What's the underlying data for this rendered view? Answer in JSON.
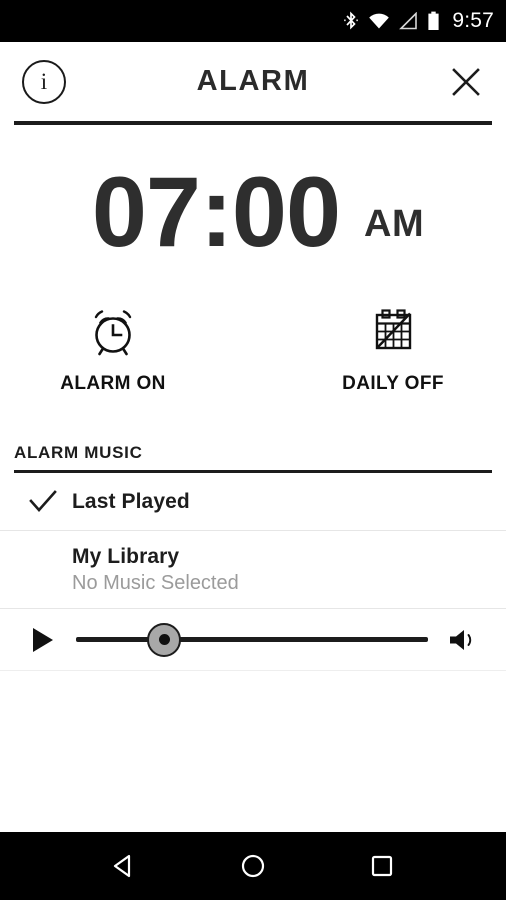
{
  "status_bar": {
    "time": "9:57",
    "icons": [
      "bluetooth-icon",
      "wifi-icon",
      "cell-signal-icon",
      "battery-icon"
    ]
  },
  "header": {
    "title": "ALARM",
    "info_icon": "info-icon",
    "info_glyph": "i",
    "close_icon": "close-icon"
  },
  "alarm": {
    "time": "07:00",
    "meridiem": "AM"
  },
  "toggles": [
    {
      "label": "ALARM ON",
      "icon": "alarm-clock-icon",
      "state": "on"
    },
    {
      "label": "DAILY OFF",
      "icon": "calendar-off-icon",
      "state": "off"
    }
  ],
  "music_section": {
    "title": "ALARM MUSIC",
    "items": [
      {
        "title": "Last Played",
        "subtitle": "",
        "checked": true
      },
      {
        "title": "My Library",
        "subtitle": "No Music Selected",
        "checked": false
      }
    ]
  },
  "player": {
    "play_icon": "play-icon",
    "volume_icon": "speaker-volume-icon",
    "volume_percent": 25
  },
  "nav_bar": {
    "back": "back-triangle-icon",
    "home": "home-circle-icon",
    "recents": "recents-square-icon"
  },
  "colors": {
    "background": "#ffffff",
    "bars": "#000000",
    "text_primary": "#1d1d1d",
    "text_muted": "#9b9b9b",
    "thumb": "#a8a8a8"
  }
}
